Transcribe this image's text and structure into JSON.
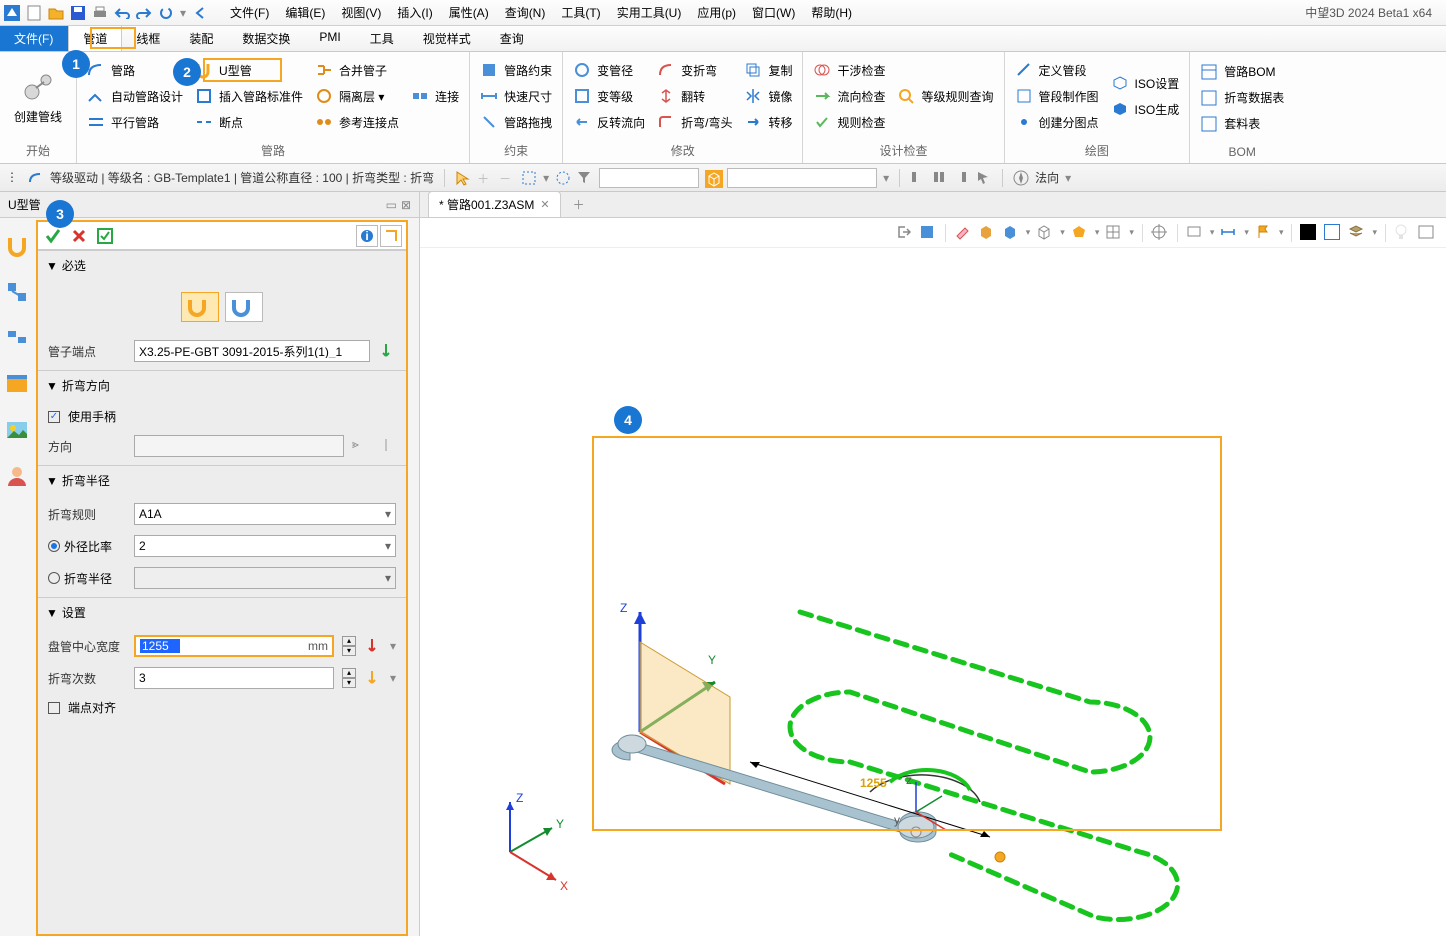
{
  "app_title": "中望3D 2024 Beta1 x64",
  "menus": [
    "文件(F)",
    "编辑(E)",
    "视图(V)",
    "插入(I)",
    "属性(A)",
    "查询(N)",
    "工具(T)",
    "实用工具(U)",
    "应用(p)",
    "窗口(W)",
    "帮助(H)"
  ],
  "ribbon_tabs": {
    "file": "文件(F)",
    "active": "管道",
    "others": [
      "线框",
      "装配",
      "数据交换",
      "PMI",
      "工具",
      "视觉样式",
      "查询"
    ]
  },
  "ribbon": {
    "start": {
      "big": "创建管线",
      "label": "开始"
    },
    "route": {
      "col1": [
        "管路",
        "自动管路设计",
        "平行管路"
      ],
      "u_btn": "U型管",
      "col2": [
        "插入管路标准件",
        "断点"
      ],
      "col3": [
        "合并管子",
        "隔离层 ▾",
        "参考连接点"
      ],
      "col4": [
        "连接"
      ],
      "label": "管路"
    },
    "constraint": {
      "items": [
        "管路约束",
        "快速尺寸",
        "管路拖拽"
      ],
      "label": "约束"
    },
    "modify": {
      "col1": [
        "变管径",
        "变等级",
        "反转流向"
      ],
      "col2": [
        "变折弯",
        "翻转",
        "折弯/弯头"
      ],
      "col3": [
        "复制",
        "镜像",
        "转移"
      ],
      "label": "修改"
    },
    "check": {
      "col1": [
        "干涉检查",
        "流向检查",
        "规则检查"
      ],
      "col2": [
        "等级规则查询"
      ],
      "label": "设计检查"
    },
    "draw": {
      "col1": [
        "定义管段",
        "管段制作图",
        "创建分图点"
      ],
      "col2": [
        "ISO设置",
        "ISO生成"
      ],
      "label": "绘图"
    },
    "bom": {
      "items": [
        "管路BOM",
        "折弯数据表",
        "套料表"
      ],
      "label": "BOM"
    }
  },
  "ctx": {
    "text": "等级驱动 | 等级名 : GB-Template1 | 管道公称直径 : 100 | 折弯类型 : 折弯",
    "view_label": "法向"
  },
  "panel": {
    "title": "U型管",
    "s1": {
      "hdr": "必选",
      "endpoint_label": "管子端点",
      "endpoint_value": "X3.25-PE-GBT 3091-2015-系列1(1)_1"
    },
    "s2": {
      "hdr": "折弯方向",
      "use_handle": "使用手柄",
      "dir_label": "方向"
    },
    "s3": {
      "hdr": "折弯半径",
      "rule_label": "折弯规则",
      "rule_value": "A1A",
      "ratio_label": "外径比率",
      "ratio_value": "2",
      "radius_label": "折弯半径"
    },
    "s4": {
      "hdr": "设置",
      "width_label": "盘管中心宽度",
      "width_value": "1255",
      "width_unit": "mm",
      "count_label": "折弯次数",
      "count_value": "3",
      "align_label": "端点对齐"
    }
  },
  "doc": {
    "tab": "* 管路001.Z3ASM",
    "dim": "1255"
  },
  "annos": {
    "a1": "1",
    "a2": "2",
    "a3": "3",
    "a4": "4"
  }
}
